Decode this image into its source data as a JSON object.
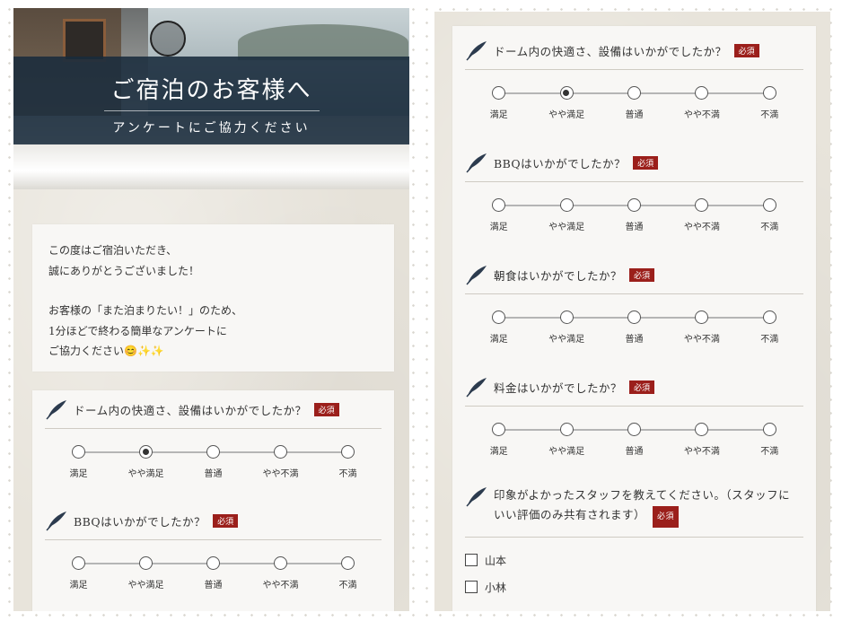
{
  "hero": {
    "title": "ご宿泊のお客様へ",
    "subtitle": "アンケートにご協力ください"
  },
  "intro": {
    "line1": "この度はご宿泊いただき、",
    "line2": "誠にありがとうございました！",
    "line3": "お客様の「また泊まりたい！」のため、",
    "line4": "1分ほどで終わる簡単なアンケートに",
    "line5": "ご協力ください😊✨✨"
  },
  "required_label": "必須",
  "scale_labels": [
    "満足",
    "やや満足",
    "普通",
    "やや不満",
    "不満"
  ],
  "questions": [
    {
      "text": "ドーム内の快適さ、設備はいかがでしたか？",
      "selected": 1
    },
    {
      "text": "BBQはいかがでしたか？",
      "selected": -1
    },
    {
      "text": "朝食はいかがでしたか？",
      "selected": -1
    },
    {
      "text": "料金はいかがでしたか？",
      "selected": -1
    }
  ],
  "staff_question": {
    "text_line1": "印象がよかったスタッフを教えてください。（スタッフに",
    "text_line2": "いい評価のみ共有されます）",
    "options": [
      "山本",
      "小林"
    ]
  },
  "icons": {
    "question_marker": "quill-icon"
  },
  "colors": {
    "required_badge": "#9b1f1b",
    "hero_band": "#192b3c"
  }
}
